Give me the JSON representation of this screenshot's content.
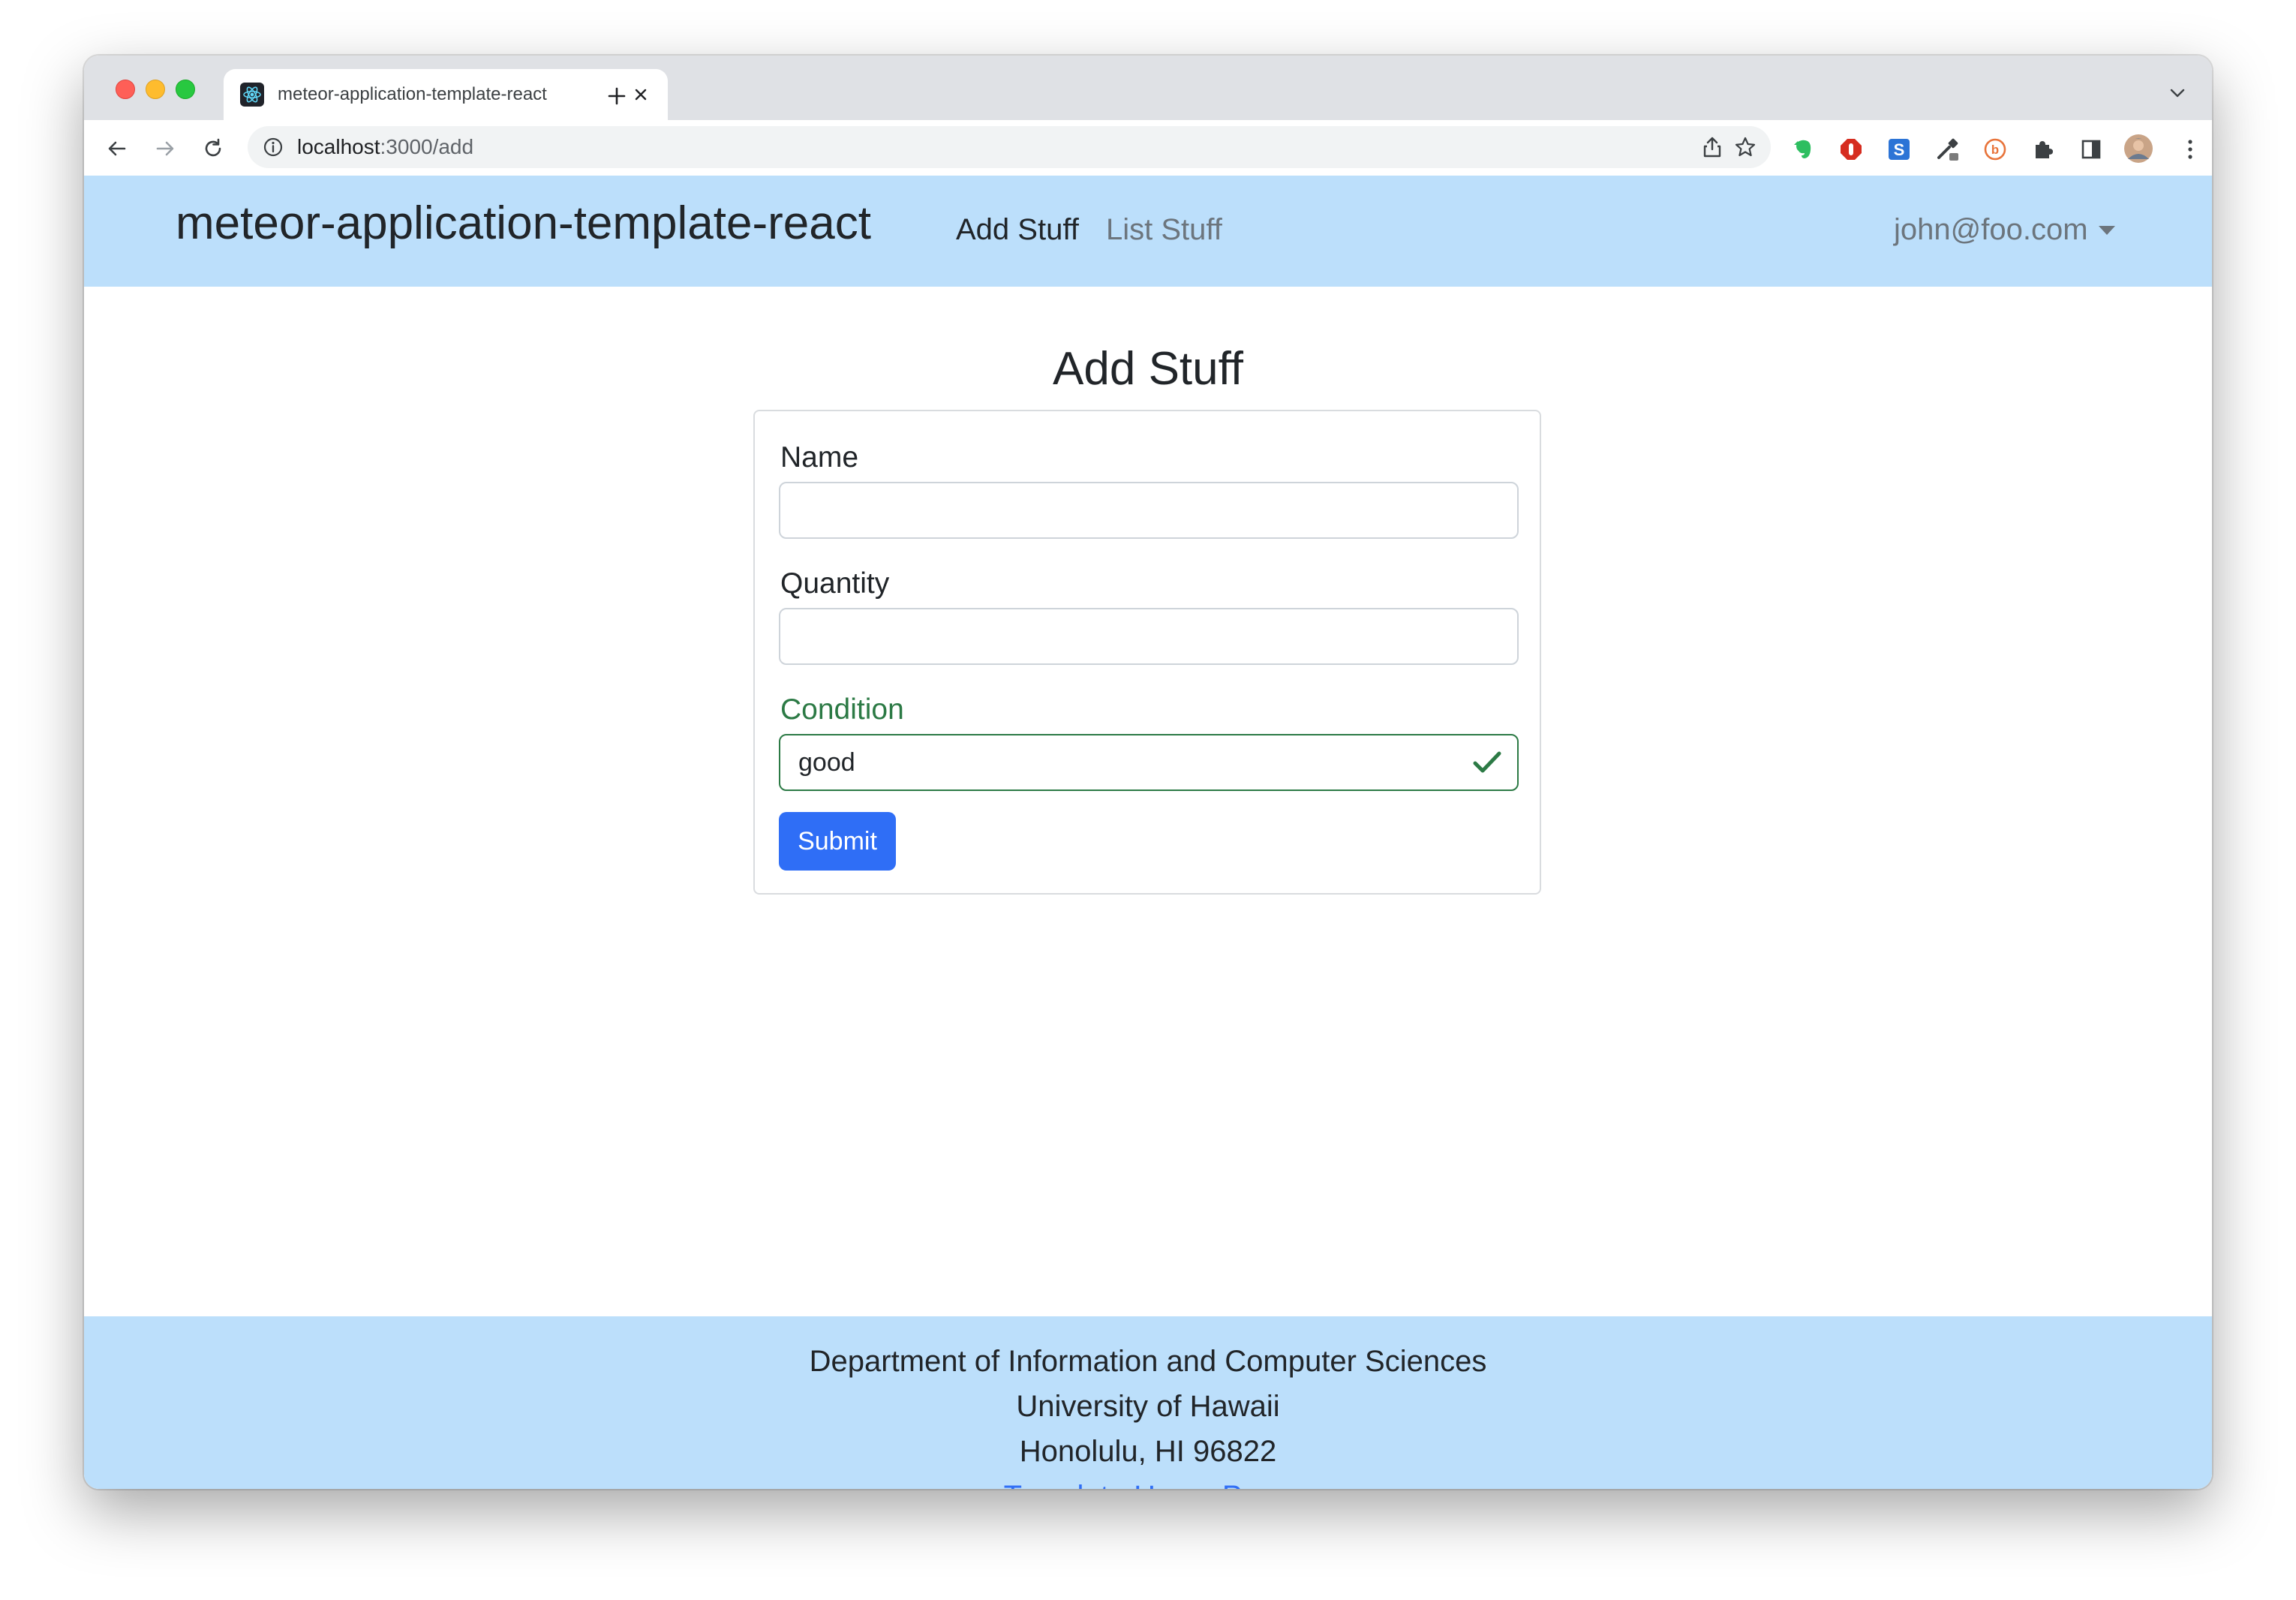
{
  "browser": {
    "tab_title": "meteor-application-template-react",
    "url_host": "localhost",
    "url_path": ":3000/add"
  },
  "navbar": {
    "brand": "meteor-application-template-react",
    "links": [
      {
        "label": "Add Stuff",
        "active": true
      },
      {
        "label": "List Stuff",
        "active": false
      }
    ],
    "user": "john@foo.com"
  },
  "form": {
    "title": "Add Stuff",
    "fields": [
      {
        "label": "Name",
        "value": "",
        "valid": false
      },
      {
        "label": "Quantity",
        "value": "",
        "valid": false
      },
      {
        "label": "Condition",
        "value": "good",
        "valid": true
      }
    ],
    "submit_label": "Submit"
  },
  "footer": {
    "line1": "Department of Information and Computer Sciences",
    "line2": "University of Hawaii",
    "line3": "Honolulu, HI 96822",
    "link": "Template Home Page"
  },
  "colors": {
    "navbar_bg": "#bcdffb",
    "primary": "#2f6ef6",
    "valid": "#2c7a45"
  }
}
